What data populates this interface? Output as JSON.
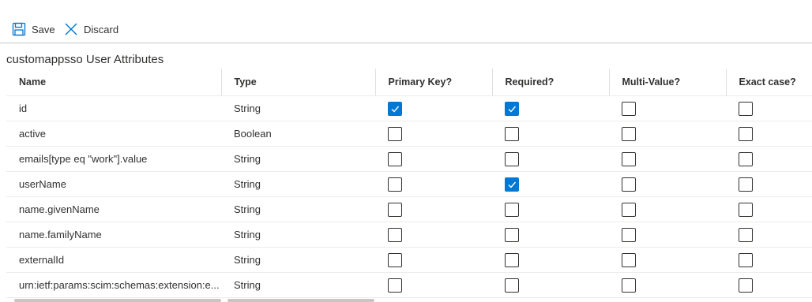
{
  "toolbar": {
    "save_label": "Save",
    "discard_label": "Discard"
  },
  "section": {
    "title": "customappsso User Attributes"
  },
  "table": {
    "columns": [
      "Name",
      "Type",
      "Primary Key?",
      "Required?",
      "Multi-Value?",
      "Exact case?"
    ],
    "rows": [
      {
        "name": "id",
        "type": "String",
        "primary_key": true,
        "required": true,
        "multi_value": false,
        "exact_case": false
      },
      {
        "name": "active",
        "type": "Boolean",
        "primary_key": false,
        "required": false,
        "multi_value": false,
        "exact_case": false
      },
      {
        "name": "emails[type eq \"work\"].value",
        "type": "String",
        "primary_key": false,
        "required": false,
        "multi_value": false,
        "exact_case": false
      },
      {
        "name": "userName",
        "type": "String",
        "primary_key": false,
        "required": true,
        "multi_value": false,
        "exact_case": false
      },
      {
        "name": "name.givenName",
        "type": "String",
        "primary_key": false,
        "required": false,
        "multi_value": false,
        "exact_case": false
      },
      {
        "name": "name.familyName",
        "type": "String",
        "primary_key": false,
        "required": false,
        "multi_value": false,
        "exact_case": false
      },
      {
        "name": "externalId",
        "type": "String",
        "primary_key": false,
        "required": false,
        "multi_value": false,
        "exact_case": false
      },
      {
        "name": "urn:ietf:params:scim:schemas:extension:e...",
        "type": "String",
        "primary_key": false,
        "required": false,
        "multi_value": false,
        "exact_case": false
      }
    ]
  },
  "colors": {
    "accent": "#0078d4",
    "text": "#323130",
    "divider": "#edebe9"
  },
  "icons": {
    "save": "floppy-disk",
    "discard": "x-mark"
  }
}
